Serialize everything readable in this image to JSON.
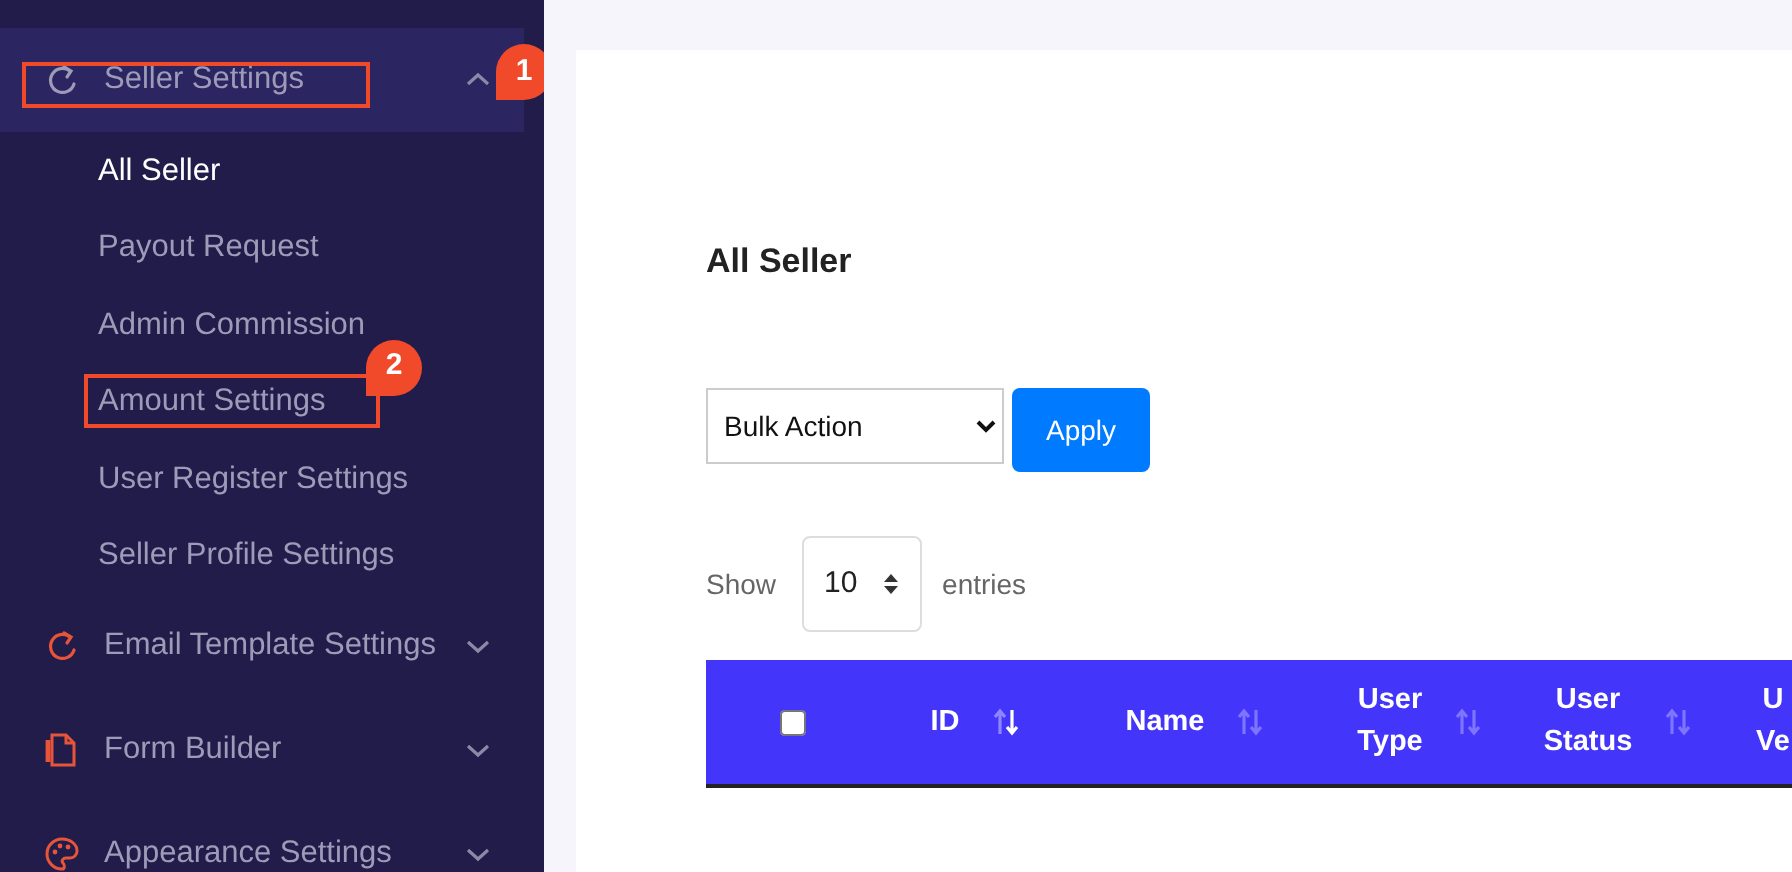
{
  "sidebar": {
    "groups": [
      {
        "label": "Seller Settings",
        "expanded": true,
        "callout": "1",
        "children": [
          {
            "label": "All Seller",
            "selected": true
          },
          {
            "label": "Payout Request",
            "selected": false
          },
          {
            "label": "Admin Commission",
            "selected": false
          },
          {
            "label": "Amount Settings",
            "selected": false,
            "callout": "2"
          },
          {
            "label": "User Register Settings",
            "selected": false
          },
          {
            "label": "Seller Profile Settings",
            "selected": false
          }
        ]
      },
      {
        "label": "Email Template Settings",
        "expanded": false
      },
      {
        "label": "Form Builder",
        "expanded": false
      },
      {
        "label": "Appearance Settings",
        "expanded": false
      }
    ]
  },
  "page": {
    "title": "All Seller",
    "bulk_action": {
      "value": "Bulk Action"
    },
    "apply_button": "Apply",
    "length": {
      "before": "Show",
      "value": "10",
      "after": "entries"
    },
    "table": {
      "select_all_checked": false,
      "columns": [
        {
          "lines": [
            "ID"
          ],
          "sorted": true
        },
        {
          "lines": [
            "Name"
          ],
          "sorted": false
        },
        {
          "lines": [
            "User",
            "Type"
          ],
          "sorted": false
        },
        {
          "lines": [
            "User",
            "Status"
          ],
          "sorted": false
        },
        {
          "lines": [
            "U",
            "Ve"
          ]
        }
      ]
    }
  }
}
